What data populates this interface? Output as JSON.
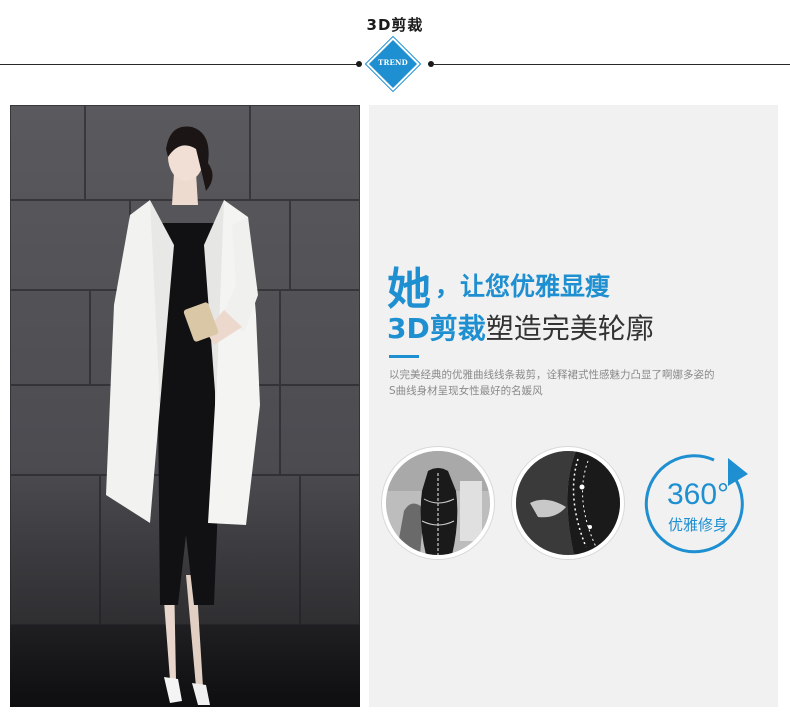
{
  "section": {
    "title": "3D剪裁",
    "badge": "TREND"
  },
  "headline": {
    "line1_big": "她",
    "line1_small": "，让您优雅显瘦",
    "line2_blue": "3D剪裁",
    "line2_rest": "塑造完美轮廓"
  },
  "description": {
    "line1": "以完美经典的优雅曲线线条裁剪，诠释裙式性感魅力凸显了啊娜多姿的",
    "line2": "S曲线身材呈现女性最好的名媛风"
  },
  "feature_360": {
    "number": "360°",
    "label": "优雅修身"
  },
  "colors": {
    "accent": "#1e8fd0",
    "panel_bg": "#f1f1f1",
    "text_dark": "#333333",
    "text_muted": "#8a8a8a"
  },
  "icons": [
    "trend-diamond-badge",
    "rotate-arrow-icon"
  ]
}
